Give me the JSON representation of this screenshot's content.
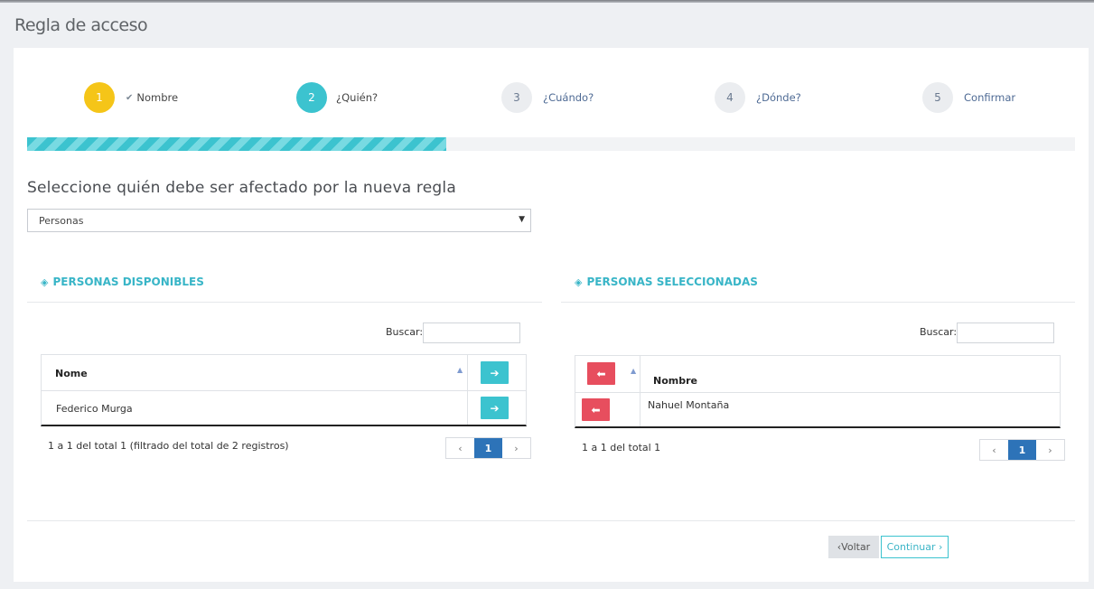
{
  "page": {
    "title": "Regla de acceso"
  },
  "wizard": {
    "steps": [
      {
        "number": "1",
        "label": "Nombre",
        "state": "done"
      },
      {
        "number": "2",
        "label": "¿Quién?",
        "state": "active"
      },
      {
        "number": "3",
        "label": "¿Cuándo?",
        "state": "pending"
      },
      {
        "number": "4",
        "label": "¿Dónde?",
        "state": "pending"
      },
      {
        "number": "5",
        "label": "Confirmar",
        "state": "pending"
      }
    ],
    "progress_percent": 40
  },
  "question": "Seleccione quién debe ser afectado por la nueva regla",
  "select": {
    "value": "Personas"
  },
  "available": {
    "title": "PERSONAS DISPONIBLES",
    "search_label": "Buscar:",
    "search_value": "",
    "column": "Nome",
    "rows": [
      {
        "name": "Federico Murga"
      }
    ],
    "info": "1 a 1 del total 1 (filtrado del total de 2 registros)",
    "pager": {
      "prev": "‹",
      "current": "1",
      "next": "›"
    }
  },
  "selected": {
    "title": "PERSONAS SELECCIONADAS",
    "search_label": "Buscar:",
    "search_value": "",
    "column": "Nombre",
    "rows": [
      {
        "name": "Nahuel Montaña"
      }
    ],
    "info": "1 a 1 del total 1",
    "pager": {
      "prev": "‹",
      "current": "1",
      "next": "›"
    }
  },
  "footer": {
    "back_label": "Voltar",
    "next_label": "Continuar"
  },
  "colors": {
    "accent": "#3cc3cf",
    "done": "#f5c518",
    "danger": "#e74e5e",
    "page_blue": "#2d73b8"
  }
}
